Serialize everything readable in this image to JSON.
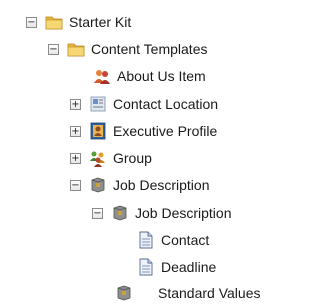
{
  "tree": {
    "nodes": [
      {
        "label": "Starter Kit",
        "toggle": "−",
        "icon": "folder-icon"
      },
      {
        "label": "Content Templates",
        "toggle": "−",
        "icon": "folder-icon"
      },
      {
        "label": "About Us Item",
        "toggle": "",
        "icon": "people-icon"
      },
      {
        "label": "Contact Location",
        "toggle": "+",
        "icon": "contact-card-icon"
      },
      {
        "label": "Executive Profile",
        "toggle": "+",
        "icon": "profile-icon"
      },
      {
        "label": "Group",
        "toggle": "+",
        "icon": "group-icon"
      },
      {
        "label": "Job Description",
        "toggle": "−",
        "icon": "gray-box-icon"
      },
      {
        "label": "Job Description",
        "toggle": "−",
        "icon": "gray-box-icon"
      },
      {
        "label": "Contact",
        "toggle": "",
        "icon": "document-icon"
      },
      {
        "label": "Deadline",
        "toggle": "",
        "icon": "document-icon"
      },
      {
        "label": "Standard Values",
        "toggle": "",
        "icon": "gray-box-icon"
      }
    ]
  },
  "colors": {
    "folder": "#f2c94c",
    "toggle_border": "#8a8a8a",
    "text": "#1a1a1a"
  }
}
